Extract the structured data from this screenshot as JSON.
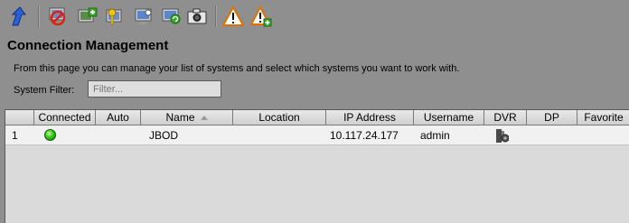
{
  "toolbar": {
    "buttons": [
      "back-arrow-icon",
      "disconnect-system-icon",
      "add-system-icon",
      "key-login-icon",
      "monitor-edit-icon",
      "monitor-refresh-icon",
      "camera-icon",
      "warning-icon",
      "warning-add-icon"
    ]
  },
  "page": {
    "title": "Connection Management",
    "description": "From this page you can manage your list of systems and select which systems you want to work with."
  },
  "filter": {
    "label": "System Filter:",
    "placeholder": "Filter..."
  },
  "table": {
    "columns": [
      "",
      "Connected",
      "Auto",
      "Name",
      "Location",
      "IP Address",
      "Username",
      "DVR",
      "DP",
      "Favorite"
    ],
    "sorted_column": "Name",
    "rows": [
      {
        "index": "1",
        "connected": "green-status-icon",
        "auto": "",
        "name": "JBOD",
        "location": "",
        "ip_address": "10.117.24.177",
        "username": "admin",
        "dvr": "dvr-icon",
        "dp": "",
        "favorite": ""
      }
    ]
  }
}
